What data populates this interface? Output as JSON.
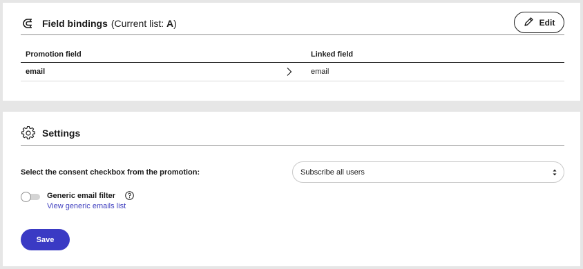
{
  "field_bindings": {
    "title": "Field bindings",
    "subtitle_prefix": "(Current list: ",
    "current_list": "A",
    "subtitle_suffix": ")",
    "edit_label": "Edit",
    "columns": [
      "Promotion field",
      "Linked field"
    ],
    "rows": [
      {
        "promotion_field": "email",
        "linked_field": "email"
      }
    ],
    "icon": "magnet-icon"
  },
  "settings": {
    "title": "Settings",
    "icon": "gear-icon",
    "consent_label": "Select the consent checkbox from the promotion:",
    "consent_select_value": "Subscribe all users",
    "generic_filter_label": "Generic email filter",
    "generic_filter_enabled": false,
    "generic_filter_link": "View generic emails list",
    "save_label": "Save"
  },
  "colors": {
    "accent": "#3a3ac4",
    "link": "#3f3fbf",
    "background": "#e6e6e6"
  }
}
